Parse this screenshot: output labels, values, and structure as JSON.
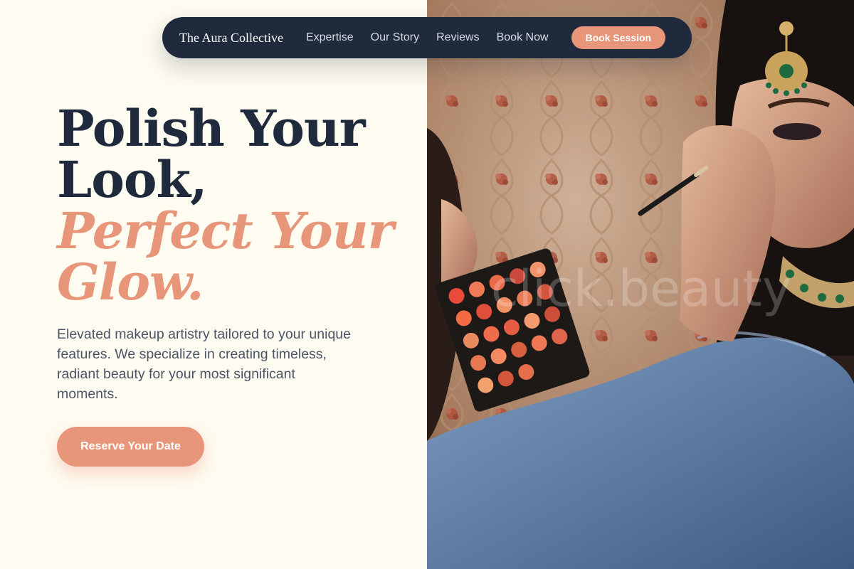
{
  "nav": {
    "brand": "The Aura Collective",
    "links": [
      "Expertise",
      "Our Story",
      "Reviews",
      "Book Now"
    ],
    "cta": "Book Session"
  },
  "hero": {
    "line1": "Polish Your",
    "line2": "Look,",
    "line3": "Perfect Your",
    "line4": "Glow.",
    "description": "Elevated makeup artistry tailored to your unique features. We specialize in creating timeless, radiant beauty for your most significant moments.",
    "cta": "Reserve Your Date"
  },
  "photo": {
    "watermark": "click.beauty"
  },
  "colors": {
    "navy": "#1f2a3c",
    "accent": "#e8967a",
    "cream": "#fefbf0"
  }
}
